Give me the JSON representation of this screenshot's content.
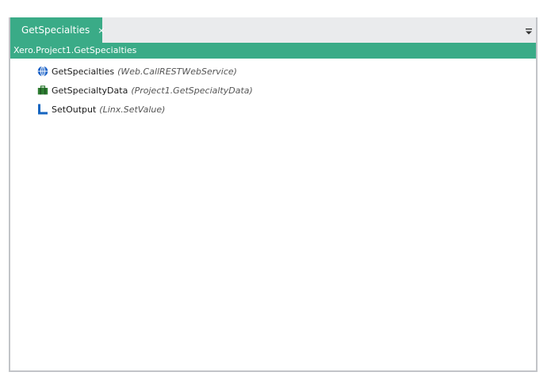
{
  "tab": {
    "label": "GetSpecialties",
    "close_glyph": "×"
  },
  "path": "Xero.Project1.GetSpecialties",
  "tree": {
    "items": [
      {
        "name": "GetSpecialties",
        "type": "(Web.CallRESTWebService)",
        "icon": "globe-icon",
        "icon_color": "#1e64c8"
      },
      {
        "name": "GetSpecialtyData",
        "type": "(Project1.GetSpecialtyData)",
        "icon": "briefcase-icon",
        "icon_color": "#2e7d32"
      },
      {
        "name": "SetOutput",
        "type": "(Linx.SetValue)",
        "icon": "set-value-icon",
        "icon_color": "#1565c0"
      }
    ]
  },
  "colors": {
    "accent": "#3aab87",
    "tabstrip_bg": "#eaebed",
    "frame_border": "#c2c4c8"
  }
}
